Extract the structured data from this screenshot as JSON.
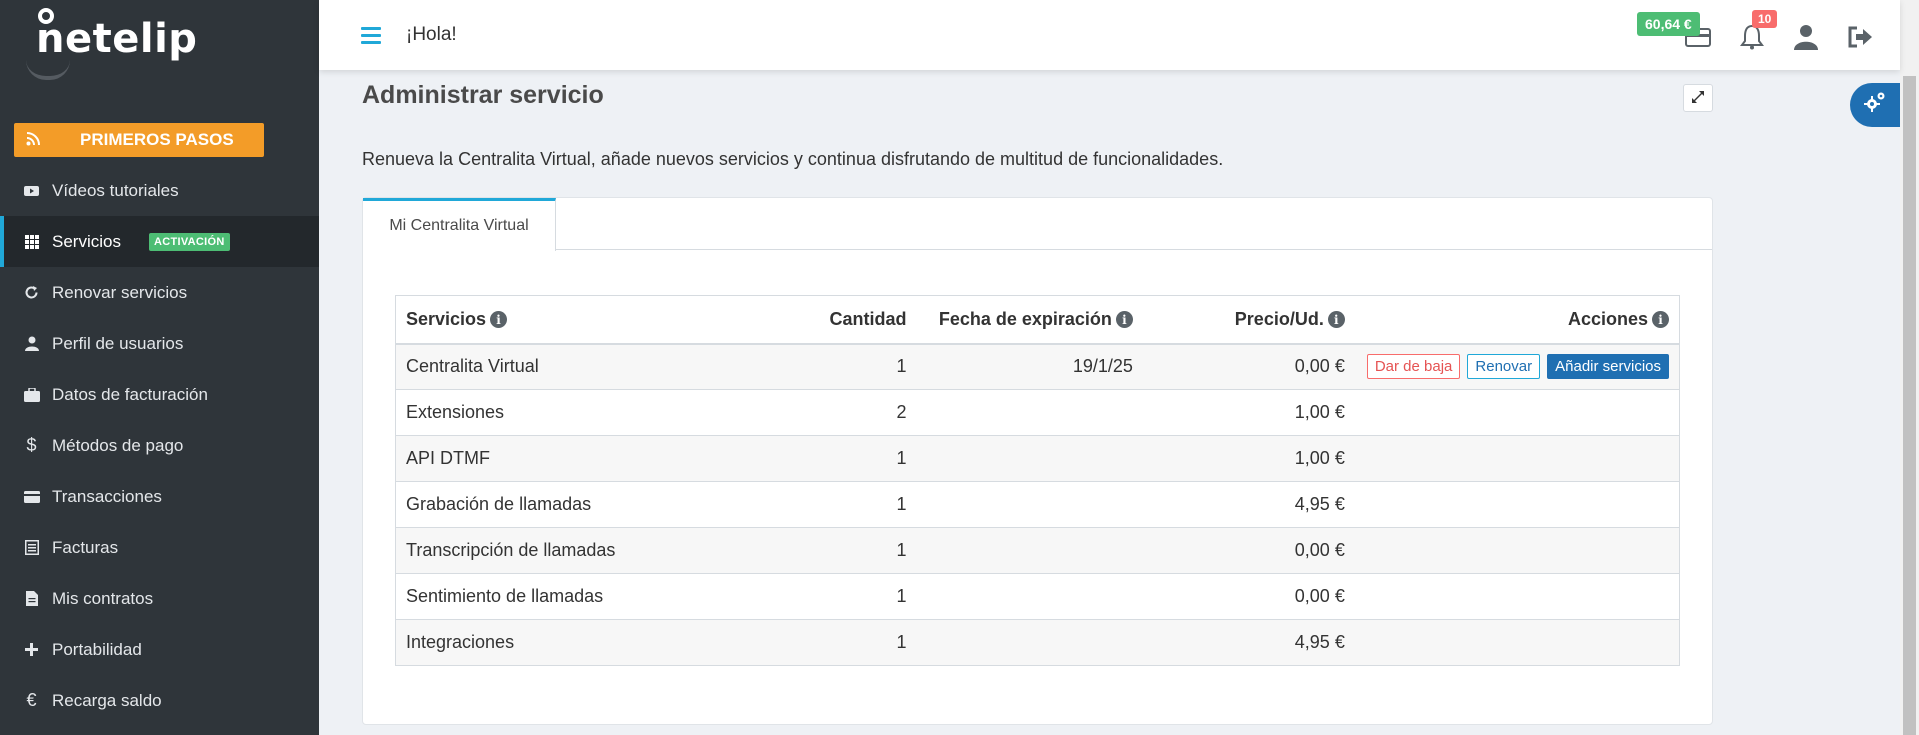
{
  "brand": {
    "name": "netelip"
  },
  "sidebar": {
    "primeros_pasos": {
      "label": "PRIMEROS PASOS",
      "icon": "rss-icon"
    },
    "items": [
      {
        "label": "Vídeos tutoriales",
        "icon": "youtube-icon"
      },
      {
        "label": "Servicios",
        "icon": "grid-icon",
        "active": true,
        "badge": "ACTIVACIÓN"
      },
      {
        "label": "Renovar servicios",
        "icon": "refresh-icon"
      },
      {
        "label": "Perfil de usuarios",
        "icon": "user-icon"
      },
      {
        "label": "Datos de facturación",
        "icon": "briefcase-icon"
      },
      {
        "label": "Métodos de pago",
        "icon": "dollar-icon"
      },
      {
        "label": "Transacciones",
        "icon": "credit-card-icon"
      },
      {
        "label": "Facturas",
        "icon": "invoice-icon"
      },
      {
        "label": "Mis contratos",
        "icon": "file-icon"
      },
      {
        "label": "Portabilidad",
        "icon": "plus-icon"
      },
      {
        "label": "Recarga saldo",
        "icon": "euro-icon"
      }
    ]
  },
  "header": {
    "greeting": "¡Hola!",
    "balance": "60,64 €",
    "notifications_count": "10"
  },
  "main": {
    "title": "Administrar servicio",
    "description": "Renueva la Centralita Virtual, añade nuevos servicios y continua disfrutando de multitud de funcionalidades.",
    "tab_label": "Mi Centralita Virtual",
    "table": {
      "columns": {
        "servicios": "Servicios",
        "cantidad": "Cantidad",
        "fecha": "Fecha de expiración",
        "precio": "Precio/Ud.",
        "acciones": "Acciones"
      },
      "rows": [
        {
          "servicio": "Centralita Virtual",
          "cantidad": "1",
          "fecha": "19/1/25",
          "precio": "0,00 €"
        },
        {
          "servicio": "Extensiones",
          "cantidad": "2",
          "fecha": "",
          "precio": "1,00 €"
        },
        {
          "servicio": "API DTMF",
          "cantidad": "1",
          "fecha": "",
          "precio": "1,00 €"
        },
        {
          "servicio": "Grabación de llamadas",
          "cantidad": "1",
          "fecha": "",
          "precio": "4,95 €"
        },
        {
          "servicio": "Transcripción de llamadas",
          "cantidad": "1",
          "fecha": "",
          "precio": "0,00 €"
        },
        {
          "servicio": "Sentimiento de llamadas",
          "cantidad": "1",
          "fecha": "",
          "precio": "0,00 €"
        },
        {
          "servicio": "Integraciones",
          "cantidad": "1",
          "fecha": "",
          "precio": "4,95 €"
        }
      ],
      "actions": {
        "dar_de_baja": "Dar de baja",
        "renovar": "Renovar",
        "anadir": "Añadir servicios"
      }
    }
  },
  "colors": {
    "sidebar_bg": "#2f353a",
    "accent_orange": "#f39c28",
    "accent_blue": "#20a8d8",
    "success_green": "#4dbd74",
    "danger_red": "#f86c6b"
  }
}
